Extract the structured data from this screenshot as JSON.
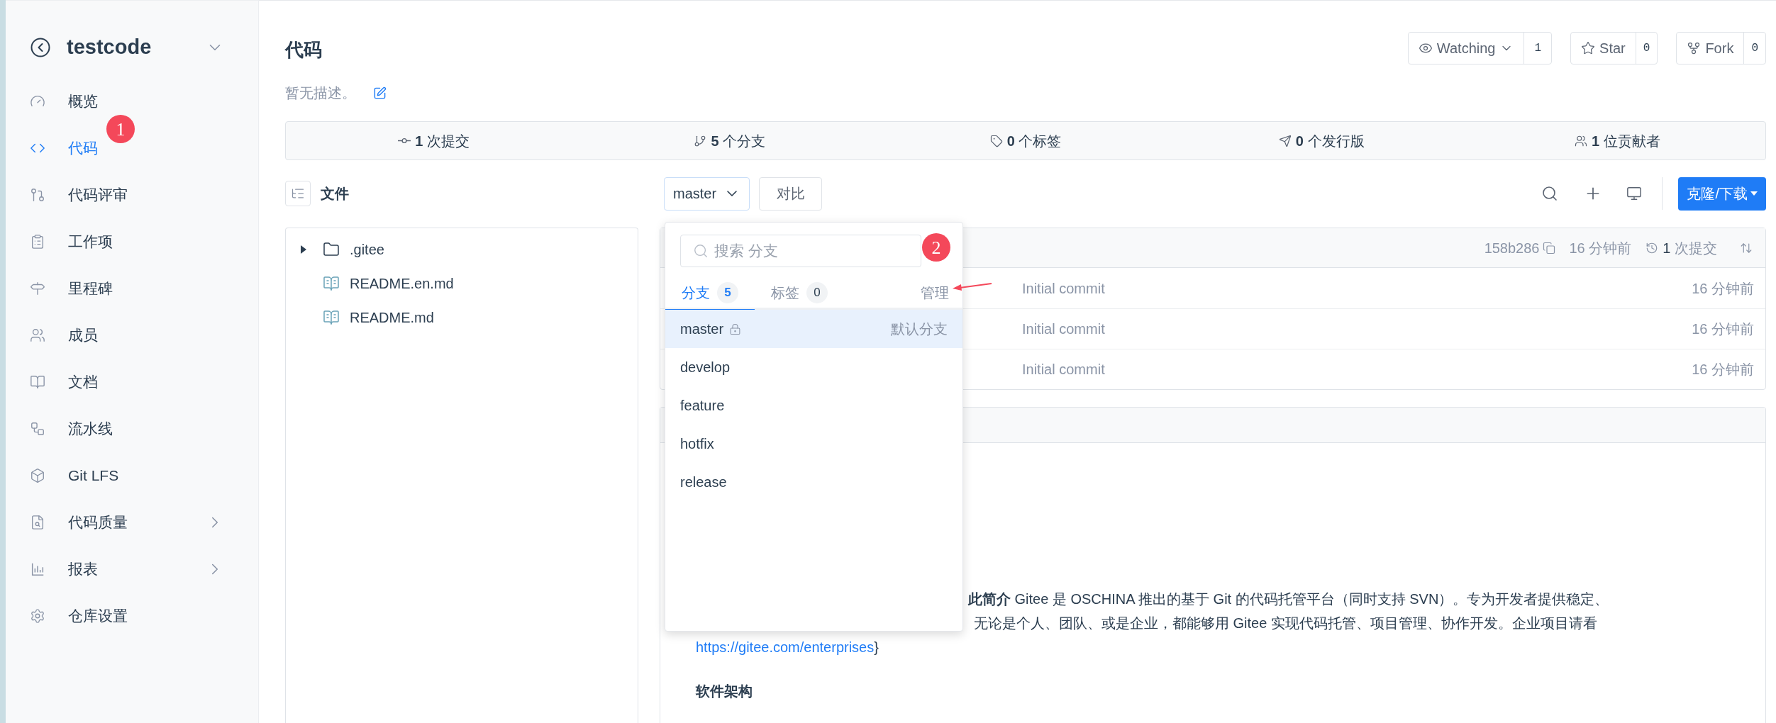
{
  "sidebar": {
    "repo_name": "testcode",
    "items": [
      {
        "label": "概览",
        "selected": false,
        "has_submenu": false
      },
      {
        "label": "代码",
        "selected": true,
        "has_submenu": false
      },
      {
        "label": "代码评审",
        "selected": false,
        "has_submenu": false
      },
      {
        "label": "工作项",
        "selected": false,
        "has_submenu": false
      },
      {
        "label": "里程碑",
        "selected": false,
        "has_submenu": false
      },
      {
        "label": "成员",
        "selected": false,
        "has_submenu": false
      },
      {
        "label": "文档",
        "selected": false,
        "has_submenu": false
      },
      {
        "label": "流水线",
        "selected": false,
        "has_submenu": false
      },
      {
        "label": "Git LFS",
        "selected": false,
        "has_submenu": false
      },
      {
        "label": "代码质量",
        "selected": false,
        "has_submenu": true
      },
      {
        "label": "报表",
        "selected": false,
        "has_submenu": true
      },
      {
        "label": "仓库设置",
        "selected": false,
        "has_submenu": false
      }
    ]
  },
  "header": {
    "title": "代码",
    "description": "暂无描述。",
    "watch": {
      "label": "Watching",
      "count": "1"
    },
    "star": {
      "label": "Star",
      "count": "0"
    },
    "fork": {
      "label": "Fork",
      "count": "0"
    }
  },
  "stats": [
    {
      "number": "1",
      "label": "次提交"
    },
    {
      "number": "5",
      "label": "个分支"
    },
    {
      "number": "0",
      "label": "个标签"
    },
    {
      "number": "0",
      "label": "个发行版"
    },
    {
      "number": "1",
      "label": "位贡献者"
    }
  ],
  "toolbar": {
    "files_label": "文件",
    "branch": "master",
    "compare": "对比",
    "clone": "克隆/下载"
  },
  "file_tree": [
    {
      "name": ".gitee",
      "kind": "folder",
      "expanded": false
    },
    {
      "name": "README.en.md",
      "kind": "file"
    },
    {
      "name": "README.md",
      "kind": "file"
    }
  ],
  "commit_header": {
    "hash": "158b286",
    "time": "16 分钟前",
    "commit_count": "1",
    "commit_label": "次提交"
  },
  "commit_rows": [
    {
      "message": "Initial commit",
      "time": "16 分钟前"
    },
    {
      "message": "Initial commit",
      "time": "16 分钟前"
    },
    {
      "message": "Initial commit",
      "time": "16 分钟前"
    }
  ],
  "readme": {
    "line_1": "**此简介** Gitee 是 OSCHINA 推出的基于 Git 的代码托管平台（同时支持 SVN）。专为开发者提供稳定、",
    "line_2": "无论是个人、团队、或是企业，都能够用 Gitee 实现代码托管、项目管理、协作开发。企业项目请看",
    "link": "https://gitee.com/enterprises",
    "after_link": "}",
    "heading": "软件架构"
  },
  "branch_dropdown": {
    "search_placeholder": "搜索 分支",
    "tabs": [
      {
        "label": "分支",
        "count": "5",
        "selected": true
      },
      {
        "label": "标签",
        "count": "0",
        "selected": false
      }
    ],
    "manage": "管理",
    "branches": [
      {
        "name": "master",
        "selected": true,
        "protected": true,
        "note": "默认分支"
      },
      {
        "name": "develop",
        "selected": false,
        "protected": false
      },
      {
        "name": "feature",
        "selected": false,
        "protected": false
      },
      {
        "name": "hotfix",
        "selected": false,
        "protected": false
      },
      {
        "name": "release",
        "selected": false,
        "protected": false
      }
    ]
  },
  "annotations": [
    {
      "number": "1"
    },
    {
      "number": "2"
    }
  ]
}
